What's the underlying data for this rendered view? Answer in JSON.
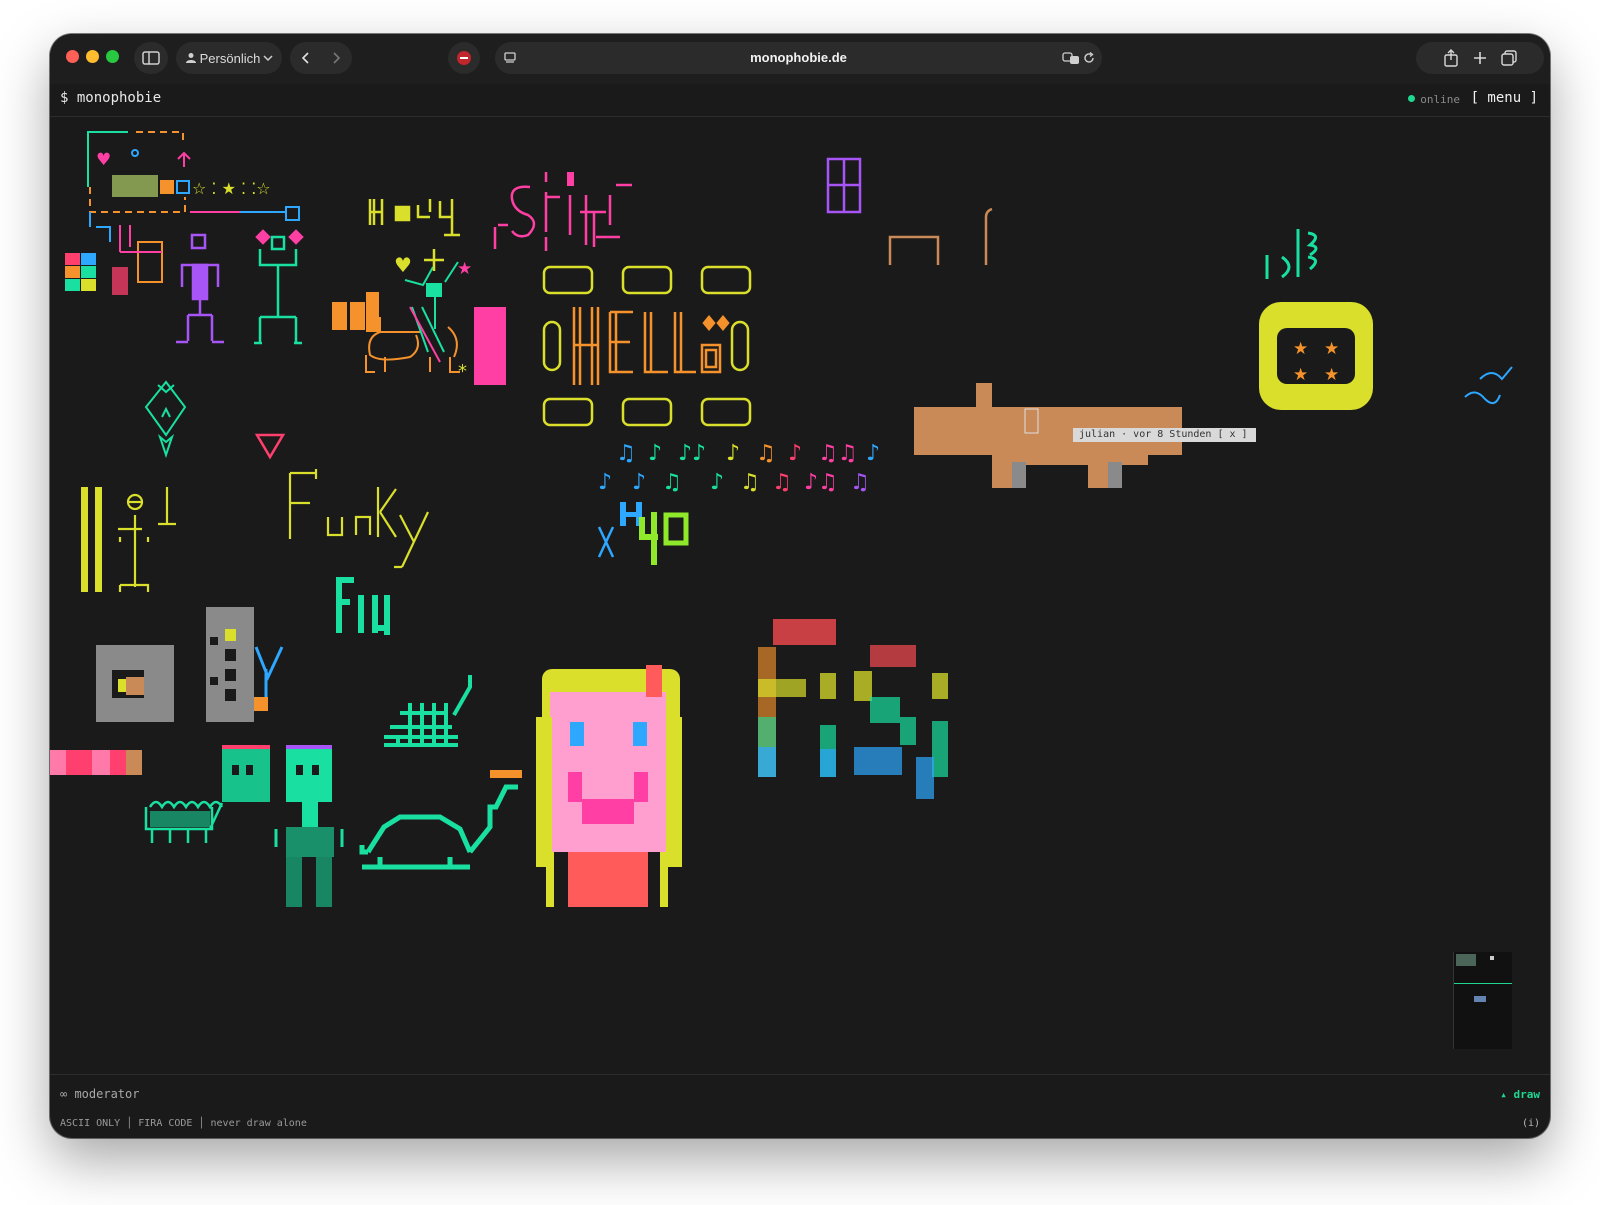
{
  "browser": {
    "profile_label": "Persönlich",
    "url": "monophobie.de",
    "icons": [
      "sidebar-icon",
      "person-icon",
      "chevron-down-icon",
      "back-icon",
      "forward-icon",
      "shield-icon",
      "reader-icon",
      "translate-icon",
      "reload-icon",
      "share-icon",
      "plus-icon",
      "tabs-icon"
    ]
  },
  "app": {
    "prompt": "$ monophobie",
    "online_label": "online",
    "menu_label": "[ menu ]"
  },
  "canvas": {
    "tooltip": "julian · vor 8 Stunden [ x ]",
    "drawings": [
      {
        "name": "h-y",
        "text": "H■ᒪ-4"
      },
      {
        "name": "shift",
        "text": "SHIFT"
      },
      {
        "name": "hello",
        "text": "HELLö"
      },
      {
        "name": "funky",
        "text": "Funky"
      },
      {
        "name": "fiji",
        "text": "Fiji"
      },
      {
        "name": "h40",
        "text": "H40"
      },
      {
        "name": "x-mark",
        "text": "X"
      },
      {
        "name": "fisy",
        "text": "Fisj"
      }
    ],
    "music_notes_row1": "♫ ♪ ♪♪ ♪ ♫ ♪ ♫♫ ♪",
    "music_notes_row2": "♪ ♪ ♫ ♪ ♫ ♫ ♪♫ ♫"
  },
  "footer": {
    "moderator": "∞ moderator",
    "draw_label": "▴ draw",
    "status": "ASCII ONLY │ FIRA CODE │ never draw alone",
    "info": "(i)"
  },
  "colors": {
    "background": "#1a1a1a",
    "online_green": "#1ed891",
    "yellow": "#d9df2a",
    "orange": "#f5922b",
    "pink": "#ff3fa4",
    "purple": "#a855f7",
    "teal": "#19e0a0",
    "blue": "#2ea7ff",
    "brown": "#c98a58"
  }
}
